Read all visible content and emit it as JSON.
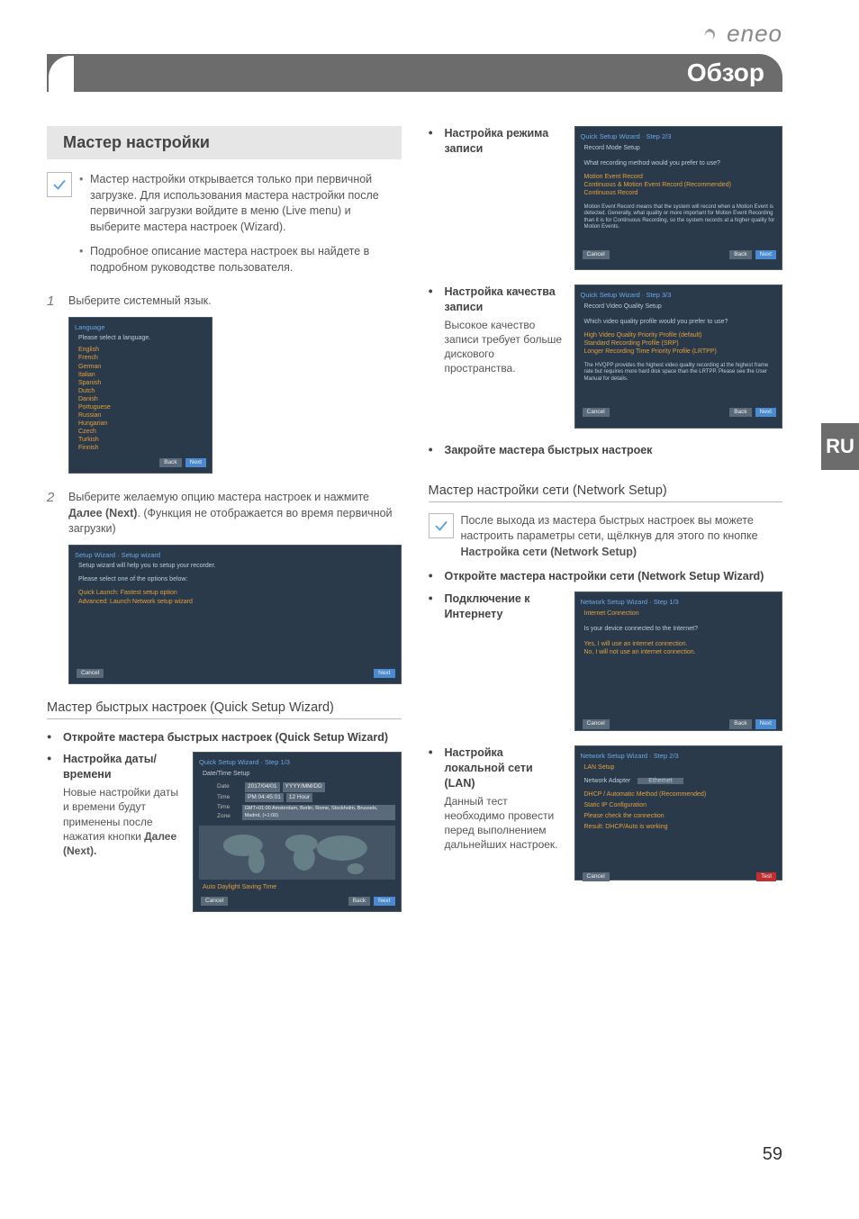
{
  "brand": "eneo",
  "header": "Обзор",
  "lang_tab": "RU",
  "page_number": "59",
  "left": {
    "section_title": "Мастер настройки",
    "notes": [
      "Мастер настройки открывается только при первичной загрузке. Для использования мастера настройки после первичной загрузки войдите в меню (Live menu) и выберите мастера настроек (Wizard).",
      "Подробное описание мастера настроек вы найдете в подробном руководстве пользователя."
    ],
    "step1": {
      "num": "1",
      "text": "Выберите системный язык."
    },
    "step2": {
      "num": "2",
      "text_a": "Выберите желаемую опцию мастера настроек и нажмите ",
      "bold": "Далее (Next)",
      "text_b": ". (Функция не отображается во время первичной загрузки)"
    },
    "subsection": "Мастер быстрых настроек (Quick Setup Wizard)",
    "bullets": {
      "b1": "Откройте мастера быстрых настроек (Quick Setup Wizard)",
      "b2": "Настройка даты/времени",
      "b2_note_a": "Новые настройки даты и времени будут применены после нажатия кнопки ",
      "b2_bold": "Далее (Next)."
    },
    "shot_lang": {
      "title": "Language",
      "prompt": "Please select a language.",
      "items": [
        "English",
        "French",
        "German",
        "Italian",
        "Spanish",
        "Dutch",
        "Danish",
        "Portuguese",
        "Russian",
        "Hungarian",
        "Czech",
        "Turkish",
        "Finnish"
      ],
      "back": "Back",
      "next": "Next"
    },
    "shot_wizard": {
      "title": "Setup Wizard · Setup wizard",
      "line1": "Setup wizard will help you to setup your recorder.",
      "line2": "Please select one of the options below:",
      "opt1": "Quick Launch: Fastest setup option",
      "opt2": "Advanced: Launch Network setup wizard",
      "cancel": "Cancel",
      "next": "Next"
    },
    "shot_date": {
      "title": "Quick Setup Wizard · Step 1/3",
      "sub": "Date/Time Setup",
      "date_lbl": "Date",
      "time_lbl": "Time",
      "tz_lbl": "Time Zone",
      "date_val": "2017/04/01",
      "date_fmt": "YYYY/MM/DD",
      "time_val": "PM 04:45:01",
      "time_fmt": "12 Hour",
      "tz_val": "GMT+01:00 Amsterdam, Berlin, Rome, Stockholm, Brussels, Madrid, (+1:00)",
      "dst": "Auto Daylight Saving Time",
      "cancel": "Cancel",
      "back": "Back",
      "next": "Next"
    }
  },
  "right": {
    "bullets": {
      "rec_mode": "Настройка режима записи",
      "rec_quality": "Настройка качества записи",
      "rec_quality_note": "Высокое качество записи требует больше дискового пространства.",
      "close_quick": "Закройте мастера быстрых настроек",
      "open_net": "Откройте мастера настройки сети (Network Setup Wizard)",
      "internet": "Подключение к Интернету",
      "lan": "Настройка локальной сети (LAN)",
      "lan_note": "Данный тест необходимо провести перед выполнением дальнейших настроек."
    },
    "subsection": "Мастер настройки сети (Network Setup)",
    "net_note_a": "После выхода из мастера быстрых настроек вы можете настроить параметры сети, щёлкнув для этого по кнопке ",
    "net_note_bold": "Настройка сети (Network Setup)",
    "shot_recmode": {
      "title": "Quick Setup Wizard · Step 2/3",
      "sub": "Record Mode Setup",
      "line1": "What recording method would you prefer to use?",
      "opts": [
        "Motion Event Record",
        "Continuous & Motion Event Record (Recommended)",
        "Continuous Record"
      ],
      "note": "Motion Event Record means that the system will record when a Motion Event is detected. Generally, what quality or more important for Motion Event Recording than it is for Continuous Recording, so the system records at a higher quality for Motion Events.",
      "cancel": "Cancel",
      "back": "Back",
      "next": "Next"
    },
    "shot_recquality": {
      "title": "Quick Setup Wizard · Step 3/3",
      "sub": "Record Video Quality Setup",
      "line1": "Which video quality profile would you prefer to use?",
      "opts": [
        "High Video Quality Priority Profile (default)",
        "Standard Recording Profile (SRP)",
        "Longer Recording Time Priority Profile (LRTPP)"
      ],
      "note": "The HVQPP provides the highest video quality recording at the highest frame rate but requires more hard disk space than the LRTPP. Please see the User Manual for details.",
      "cancel": "Cancel",
      "back": "Back",
      "next": "Next"
    },
    "shot_internet": {
      "title": "Network Setup Wizard · Step 1/3",
      "sub": "Internet Connection",
      "line1": "Is your device connected to the Internet?",
      "opts": [
        "Yes, I will use an internet connection.",
        "No, I will not use an internet connection."
      ],
      "cancel": "Cancel",
      "back": "Back",
      "next": "Next"
    },
    "shot_lan": {
      "title": "Network Setup Wizard · Step 2/3",
      "sub": "LAN Setup",
      "row_lbl": "Network Adapter",
      "row_val": "Ethernet",
      "opts": [
        "DHCP / Automatic Method (Recommended)",
        "Static IP Configuration",
        "Please check the connection",
        "Result: DHCP/Auto is working"
      ],
      "cancel": "Cancel",
      "test": "Test"
    }
  }
}
